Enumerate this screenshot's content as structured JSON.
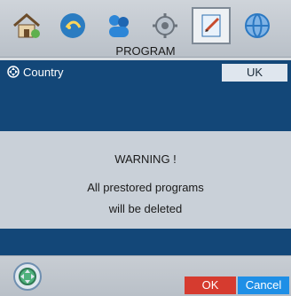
{
  "menu": {
    "title": "PROGRAM",
    "icons": [
      {
        "name": "home-icon"
      },
      {
        "name": "sound-icon"
      },
      {
        "name": "people-icon"
      },
      {
        "name": "settings-gear-icon"
      },
      {
        "name": "edit-program-icon",
        "selected": true
      },
      {
        "name": "globe-icon"
      }
    ]
  },
  "program": {
    "country_label": "Country",
    "country_value": "UK"
  },
  "warning": {
    "title": "WARNING !",
    "line1": "All prestored programs",
    "line2": "will be deleted"
  },
  "buttons": {
    "ok": "OK",
    "cancel": "Cancel"
  },
  "colors": {
    "main_bg": "#134778",
    "ok": "#d63b2f",
    "cancel": "#1e8fe6"
  }
}
